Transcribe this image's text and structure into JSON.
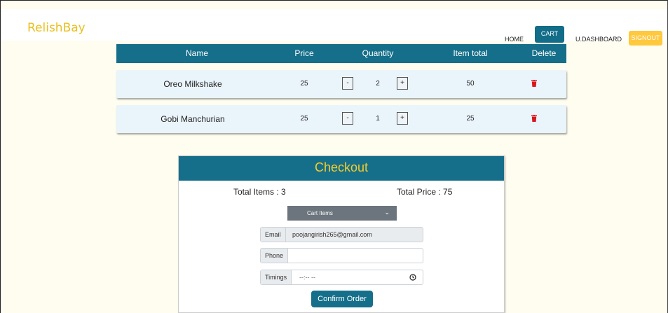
{
  "nav": {
    "brand": "RelishBay",
    "home": "HOME",
    "cart": "CART",
    "dashboard": "U.DASHBOARD",
    "signout": "SIGNOUT"
  },
  "table": {
    "headers": [
      "Name",
      "Price",
      "Quantity",
      "Item total",
      "Delete"
    ],
    "rows": [
      {
        "name": "Oreo Milkshake",
        "price": "25",
        "quantity": "2",
        "total": "50"
      },
      {
        "name": "Gobi Manchurian",
        "price": "25",
        "quantity": "1",
        "total": "25"
      }
    ],
    "minus": "-",
    "plus": "+"
  },
  "checkout": {
    "title": "Checkout",
    "total_items": "Total Items : 3",
    "total_price": "Total Price : 75",
    "select_label": "Cart Items",
    "email_label": "Email",
    "email_value": "poojangirish265@gmail.com",
    "phone_label": "Phone",
    "phone_value": "",
    "timings_label": "Timings",
    "timings_value": "--:-- --",
    "confirm": "Confirm Order"
  },
  "colors": {
    "primary": "#166f8a",
    "brand": "#e8c021",
    "signout": "#ffc83d",
    "delete": "#d9161b",
    "background": "#fffdf0"
  },
  "icons": {
    "delete": "trash-icon",
    "select": "chevron-down-icon",
    "time": "clock-icon"
  }
}
